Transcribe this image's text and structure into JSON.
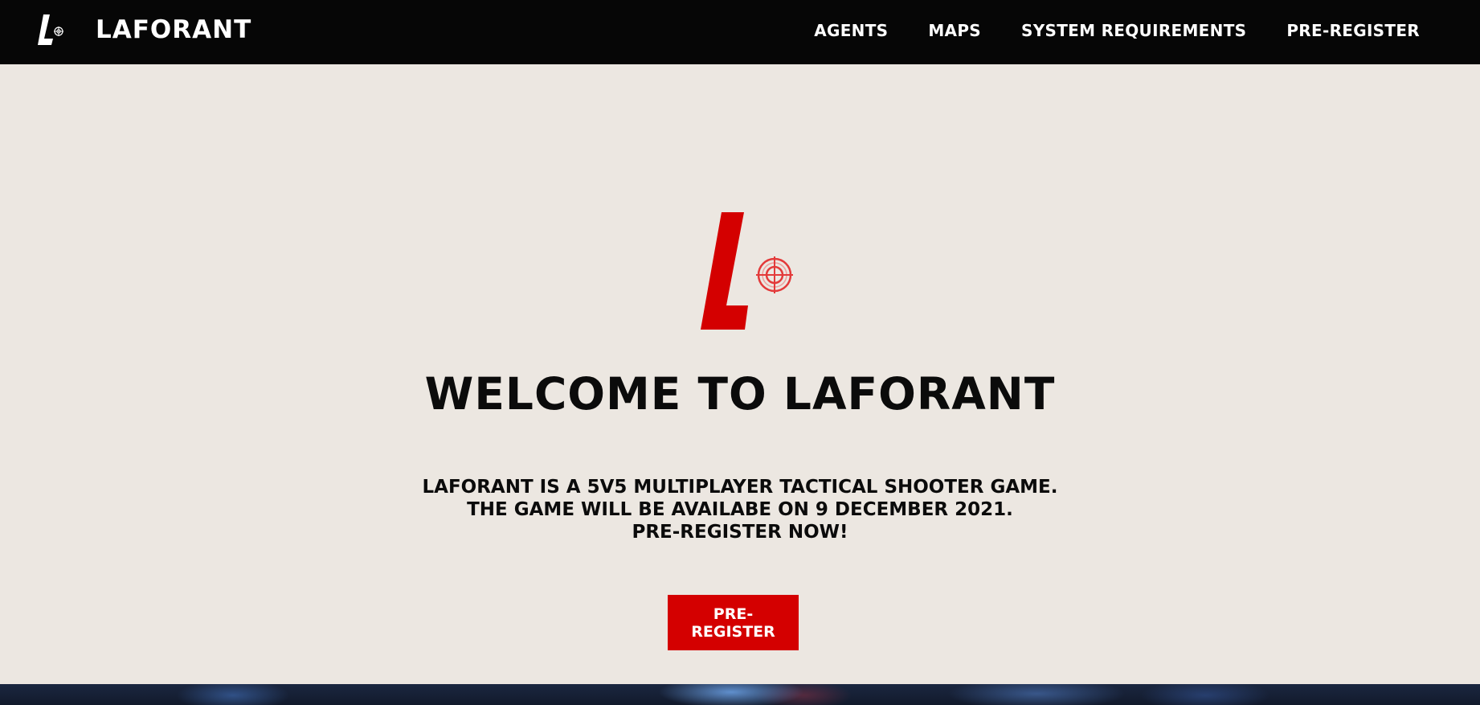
{
  "brand": {
    "name": "LAFORANT",
    "colors": {
      "nav_bg": "#060606",
      "page_bg": "#ece7e1",
      "accent": "#d40000",
      "text": "#0b0b0b"
    }
  },
  "nav": {
    "items": [
      {
        "label": "AGENTS"
      },
      {
        "label": "MAPS"
      },
      {
        "label": "SYSTEM REQUIREMENTS"
      },
      {
        "label": "PRE-REGISTER"
      }
    ]
  },
  "hero": {
    "logo_icon": "laforant-l-crosshair-logo",
    "title": "WELCOME TO LAFORANT",
    "description_lines": [
      "LAFORANT IS A 5V5 MULTIPLAYER TACTICAL SHOOTER GAME.",
      "THE GAME WILL BE AVAILABE ON 9 DECEMBER 2021.",
      "PRE-REGISTER NOW!"
    ],
    "cta_label": "PRE-REGISTER"
  },
  "footer_banner": {
    "icon": "game-art-banner"
  }
}
